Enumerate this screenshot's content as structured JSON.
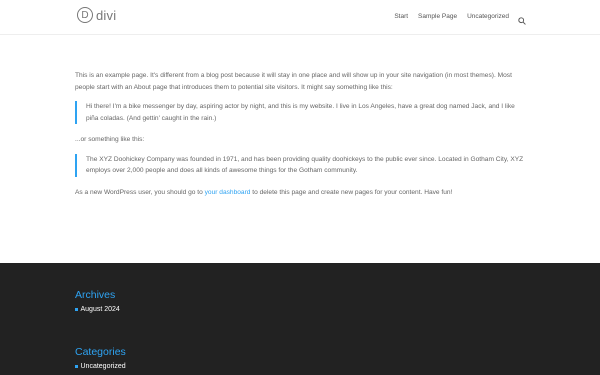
{
  "header": {
    "logo_letter": "D",
    "logo_text": "divi",
    "nav": [
      "Start",
      "Sample Page",
      "Uncategorized"
    ],
    "search_icon": "search-icon"
  },
  "page": {
    "intro": "This is an example page. It's different from a blog post because it will stay in one place and will show up in your site navigation (in most themes). Most people start with an About page that introduces them to potential site visitors. It might say something like this:",
    "quote1": "Hi there! I'm a bike messenger by day, aspiring actor by night, and this is my website. I live in Los Angeles, have a great dog named Jack, and I like piña coladas. (And gettin' caught in the rain.)",
    "mid": "...or something like this:",
    "quote2": "The XYZ Doohickey Company was founded in 1971, and has been providing quality doohickeys to the public ever since. Located in Gotham City, XYZ employs over 2,000 people and does all kinds of awesome things for the Gotham community.",
    "outro_before": "As a new WordPress user, you should go to ",
    "outro_link": "your dashboard",
    "outro_after": " to delete this page and create new pages for your content. Have fun!"
  },
  "footer": {
    "archives": {
      "title": "Archives",
      "items": [
        "August 2024"
      ]
    },
    "categories": {
      "title": "Categories",
      "items": [
        "Uncategorized"
      ]
    }
  },
  "colors": {
    "accent": "#2ea3f2",
    "footer_bg": "#222222",
    "text": "#666666"
  }
}
